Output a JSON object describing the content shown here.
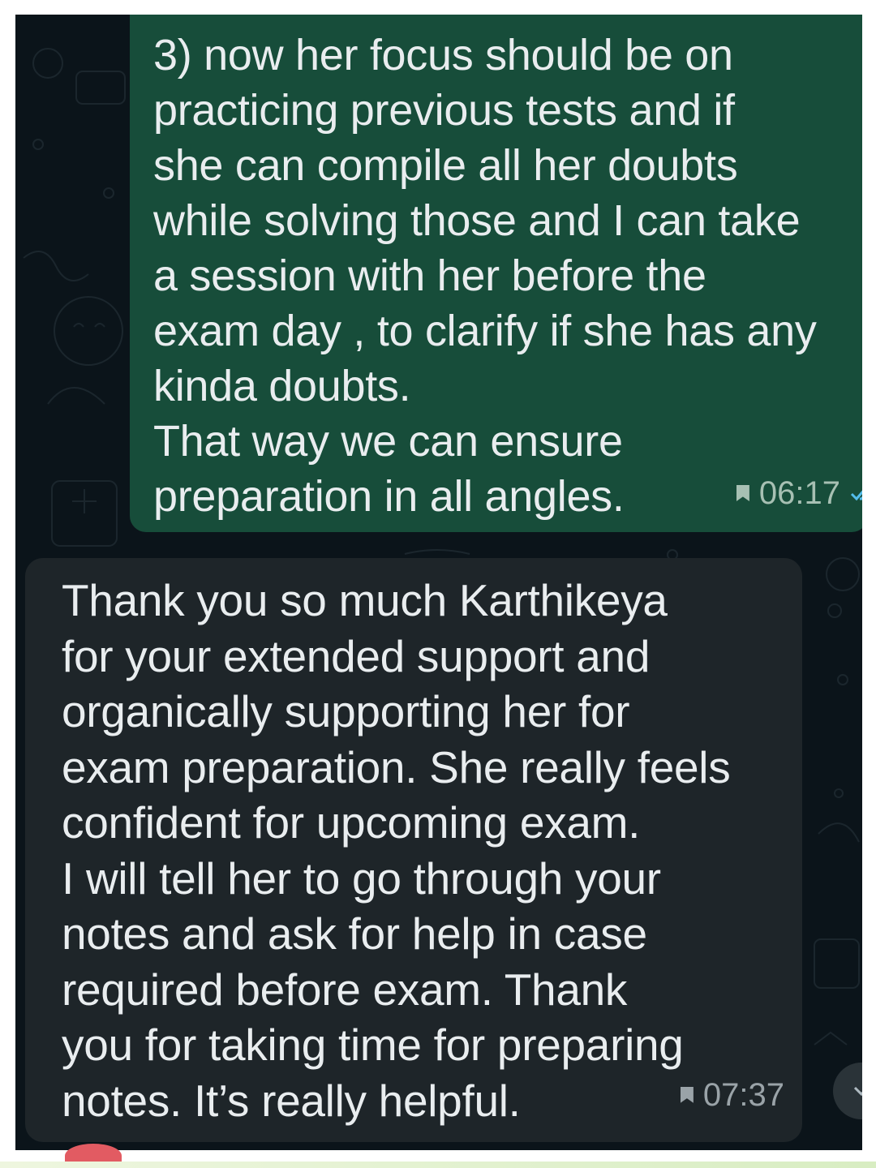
{
  "chat": {
    "messages": [
      {
        "direction": "outgoing",
        "text": "3) now her focus should be on\npracticing previous tests and if\nshe can compile all her doubts\nwhile solving those and I can take\na session with her before the\nexam day , to clarify if she has any\nkinda doubts.\nThat way we can ensure\npreparation in all angles.",
        "time": "06:17",
        "status_icon": "double-check-icon"
      },
      {
        "direction": "incoming",
        "text": "Thank you so much Karthikeya\nfor your extended support and\norganically supporting her for\nexam preparation. She really feels\nconfident for upcoming exam.\nI will tell her to go through your\nnotes and ask for help in case\nrequired before exam. Thank\nyou for taking time for preparing\nnotes. It’s really helpful.",
        "time": "07:37"
      }
    ]
  },
  "colors": {
    "chat_background": "#0b141a",
    "outgoing_bubble": "#174d3a",
    "incoming_bubble": "#1e2529",
    "message_text": "#e9edef",
    "read_ticks": "#53bdeb"
  },
  "icons": {
    "pinned": "pin-icon",
    "read_receipt": "double-check-icon",
    "scroll_down": "chevron-down-icon"
  }
}
